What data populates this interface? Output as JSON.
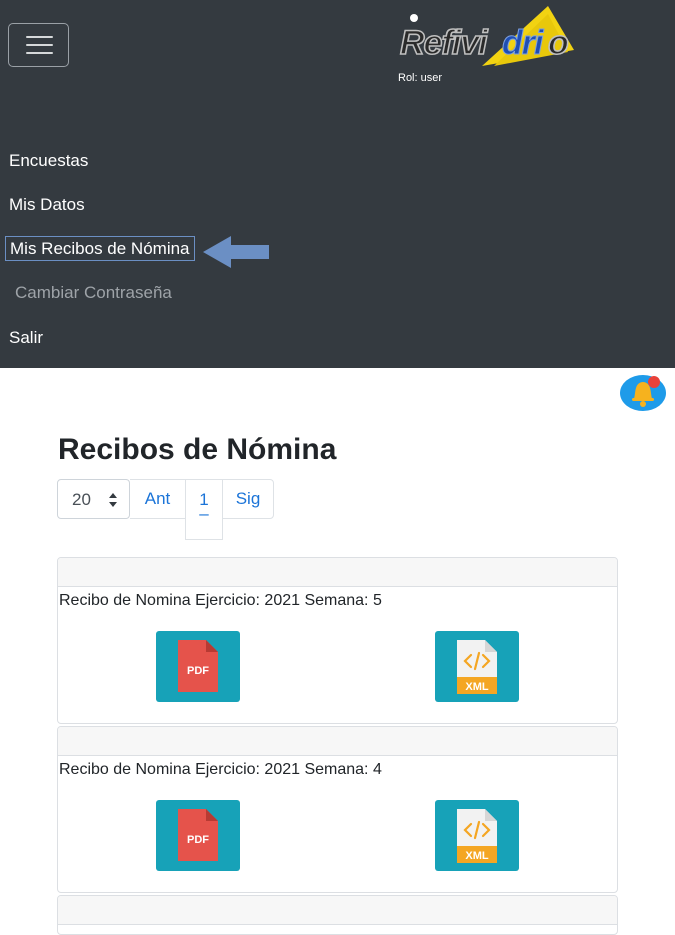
{
  "navbar": {
    "logo_text": "Refividrio",
    "role": "Rol: user",
    "menu": [
      {
        "label": "Encuestas"
      },
      {
        "label": "Mis Datos"
      },
      {
        "label": "Mis Recibos de Nómina"
      },
      {
        "label": "Cambiar Contraseña"
      },
      {
        "label": "Salir"
      }
    ]
  },
  "main": {
    "title": "Recibos de Nómina",
    "page_size": "20",
    "pagination": {
      "prev": "Ant",
      "current": "1",
      "current_marker": "–",
      "next": "Sig"
    },
    "receipts": [
      {
        "title": "Recibo de Nomina Ejercicio: 2021 Semana: 5",
        "pdf_label": "PDF",
        "xml_label": "XML"
      },
      {
        "title": "Recibo de Nomina Ejercicio: 2021 Semana: 4",
        "pdf_label": "PDF",
        "xml_label": "XML"
      }
    ]
  },
  "icons": [
    "menu-icon",
    "bell-icon",
    "pdf-file-icon",
    "xml-file-icon",
    "arrow-left-icon"
  ],
  "colors": {
    "navbar": "#343a40",
    "button": "#17a2b8",
    "link": "#1b74d8",
    "pdf": "#e5534b",
    "xml": "#f4a623"
  }
}
